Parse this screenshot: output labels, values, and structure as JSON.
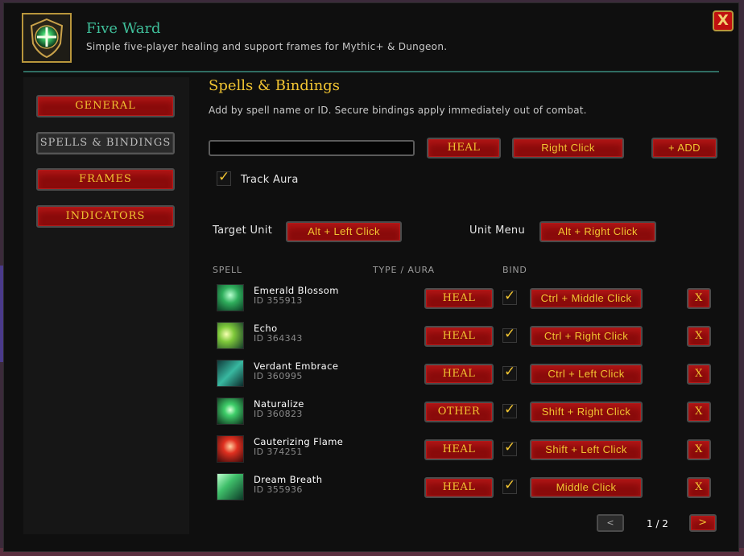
{
  "app": {
    "title": "Five Ward",
    "subtitle": "Simple five-player healing and support frames for Mythic+ & Dungeon.",
    "close_label": "X"
  },
  "sidebar": {
    "items": [
      {
        "label": "GENERAL",
        "active": false
      },
      {
        "label": "SPELLS & BINDINGS",
        "active": true
      },
      {
        "label": "FRAMES",
        "active": false
      },
      {
        "label": "INDICATORS",
        "active": false
      }
    ]
  },
  "main": {
    "title": "Spells & Bindings",
    "description": "Add by spell name or ID. Secure bindings apply immediately out of combat.",
    "spell_input": {
      "value": "",
      "placeholder": ""
    },
    "type_button": "HEAL",
    "binding_button": "Right Click",
    "add_button": "+ ADD",
    "track_aura": {
      "label": "Track Aura",
      "checked": true
    },
    "target_unit": {
      "label": "Target Unit",
      "binding": "Alt + Left Click"
    },
    "unit_menu": {
      "label": "Unit Menu",
      "binding": "Alt + Right Click"
    },
    "columns": {
      "spell": "SPELL",
      "type": "TYPE / AURA",
      "bind": "BIND"
    },
    "spells": [
      {
        "name": "Emerald Blossom",
        "id": "ID 355913",
        "type": "HEAL",
        "bind_checked": true,
        "binding": "Ctrl + Middle Click",
        "remove": "X",
        "icon": "emerald-blossom-icon"
      },
      {
        "name": "Echo",
        "id": "ID 364343",
        "type": "HEAL",
        "bind_checked": true,
        "binding": "Ctrl + Right Click",
        "remove": "X",
        "icon": "echo-icon"
      },
      {
        "name": "Verdant Embrace",
        "id": "ID 360995",
        "type": "HEAL",
        "bind_checked": true,
        "binding": "Ctrl + Left Click",
        "remove": "X",
        "icon": "verdant-embrace-icon"
      },
      {
        "name": "Naturalize",
        "id": "ID 360823",
        "type": "OTHER",
        "bind_checked": true,
        "binding": "Shift + Right Click",
        "remove": "X",
        "icon": "naturalize-icon"
      },
      {
        "name": "Cauterizing Flame",
        "id": "ID 374251",
        "type": "HEAL",
        "bind_checked": true,
        "binding": "Shift + Left Click",
        "remove": "X",
        "icon": "cauterizing-flame-icon"
      },
      {
        "name": "Dream Breath",
        "id": "ID 355936",
        "type": "HEAL",
        "bind_checked": true,
        "binding": "Middle Click",
        "remove": "X",
        "icon": "dream-breath-icon"
      }
    ],
    "pager": {
      "prev": "<",
      "next": ">",
      "text": "1 / 2"
    }
  },
  "colors": {
    "accent_gold": "#f2c532",
    "button_red": "#8a0b0b",
    "title_teal": "#3fbf9a"
  }
}
